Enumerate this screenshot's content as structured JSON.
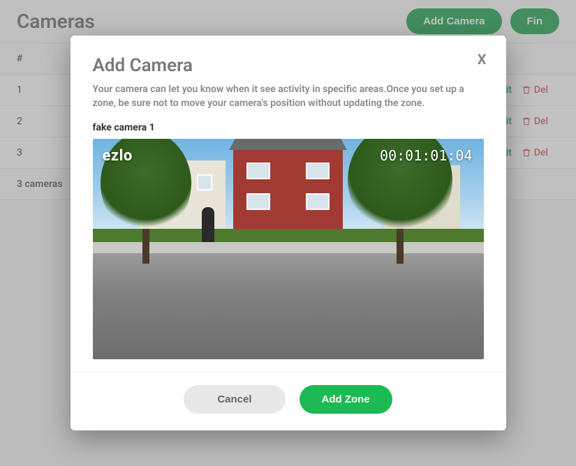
{
  "header": {
    "title": "Cameras",
    "add_button": "Add Camera",
    "find_button": "Fin"
  },
  "table": {
    "col_index": "#",
    "rows": [
      {
        "idx": "1",
        "edit": "Edit",
        "delete": "Del"
      },
      {
        "idx": "2",
        "edit": "Edit",
        "delete": "Del"
      },
      {
        "idx": "3",
        "edit": "Edit",
        "delete": "Del"
      }
    ],
    "summary": "3 cameras"
  },
  "modal": {
    "title": "Add Camera",
    "close": "X",
    "description": "Your camera can let you know when it see activity in specific areas.Once you set up a zone, be sure not to move your camera's position without updating the zone.",
    "camera_name": "fake camera 1",
    "logo_text": "ezlo",
    "timestamp": "00:01:01:04",
    "cancel": "Cancel",
    "add_zone": "Add Zone"
  }
}
